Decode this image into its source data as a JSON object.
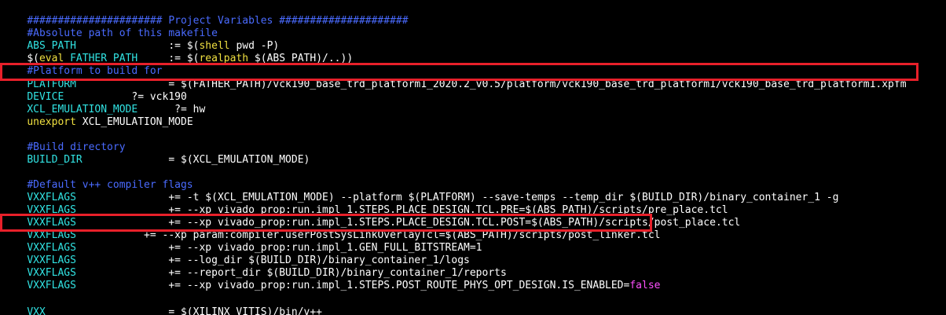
{
  "lines": {
    "l0": {
      "a": "###################### Project Variables #####################"
    },
    "l1": {
      "a": "#Absolute path of this makefile"
    },
    "l2": {
      "a": "ABS_PATH",
      "b": "               := $(",
      "c": "shell",
      "d": " pwd -P)"
    },
    "l3": {
      "a": "$(",
      "b": "eval",
      "c": " FATHER_PATH",
      "d": "     := $(",
      "e": "realpath",
      "f": " $(ABS_PATH)/..))"
    },
    "l4": {
      "a": "#Platform to build for"
    },
    "l5": {
      "a": "PLATFORM",
      "b": "               = $(FATHER_PATH)/vck190_base_trd_platform1_2020.2_v0.5/platform/vck190_base_trd_platform1/vck190_base_trd_platform1.xpfm"
    },
    "l6": {
      "a": "DEVICE",
      "b": "           ?= vck190"
    },
    "l7": {
      "a": "XCL_EMULATION_MODE",
      "b": "      ?= hw"
    },
    "l8": {
      "a": "unexport",
      "b": " XCL_EMULATION_MODE"
    },
    "l10": {
      "a": "#Build directory"
    },
    "l11": {
      "a": "BUILD_DIR",
      "b": "              = $(XCL_EMULATION_MODE)"
    },
    "l13": {
      "a": "#Default v++ compiler flags"
    },
    "l14": {
      "a": "VXXFLAGS",
      "b": "               += -t $(XCL_EMULATION_MODE) --platform $(PLATFORM) --save-temps --temp_dir $(BUILD_DIR)/binary_container_1 -g"
    },
    "l15": {
      "a": "VXXFLAGS",
      "b": "               += --xp vivado_prop:run.impl_1.STEPS.PLACE_DESIGN.TCL.PRE=$(ABS_PATH)/scripts/pre_place.tcl"
    },
    "l16": {
      "a": "VXXFLAGS",
      "b": "               += --xp vivado_prop:run.impl_1.STEPS.PLACE_DESIGN.TCL.POST=$(ABS_PATH)/scripts/post_place.tcl"
    },
    "l17": {
      "a": "VXXFLAGS",
      "b": "           += --xp param:compiler.userPostSysLinkOverlayTcl=$(ABS_PATH)/scripts/post_linker.tcl"
    },
    "l18": {
      "a": "VXXFLAGS",
      "b": "               += --xp vivado_prop:run.impl_1.GEN_FULL_BITSTREAM=1"
    },
    "l19": {
      "a": "VXXFLAGS",
      "b": "               += --log_dir $(BUILD_DIR)/binary_container_1/logs"
    },
    "l20": {
      "a": "VXXFLAGS",
      "b": "               += --report_dir $(BUILD_DIR)/binary_container_1/reports"
    },
    "l21": {
      "a": "VXXFLAGS",
      "b": "               += --xp vivado_prop:run.impl_1.STEPS.POST_ROUTE_PHYS_OPT_DESIGN.IS_ENABLED=",
      "c": "false"
    },
    "l23": {
      "a": "VXX",
      "b": "                    = $(XILINX_VITIS)/bin/v++"
    }
  },
  "colors": {
    "comment": "#4a6bff",
    "variable": "#31e3e3",
    "keyword": "#f0e040",
    "boolean": "#ff50ff",
    "highlight_box": "#e8202a"
  }
}
